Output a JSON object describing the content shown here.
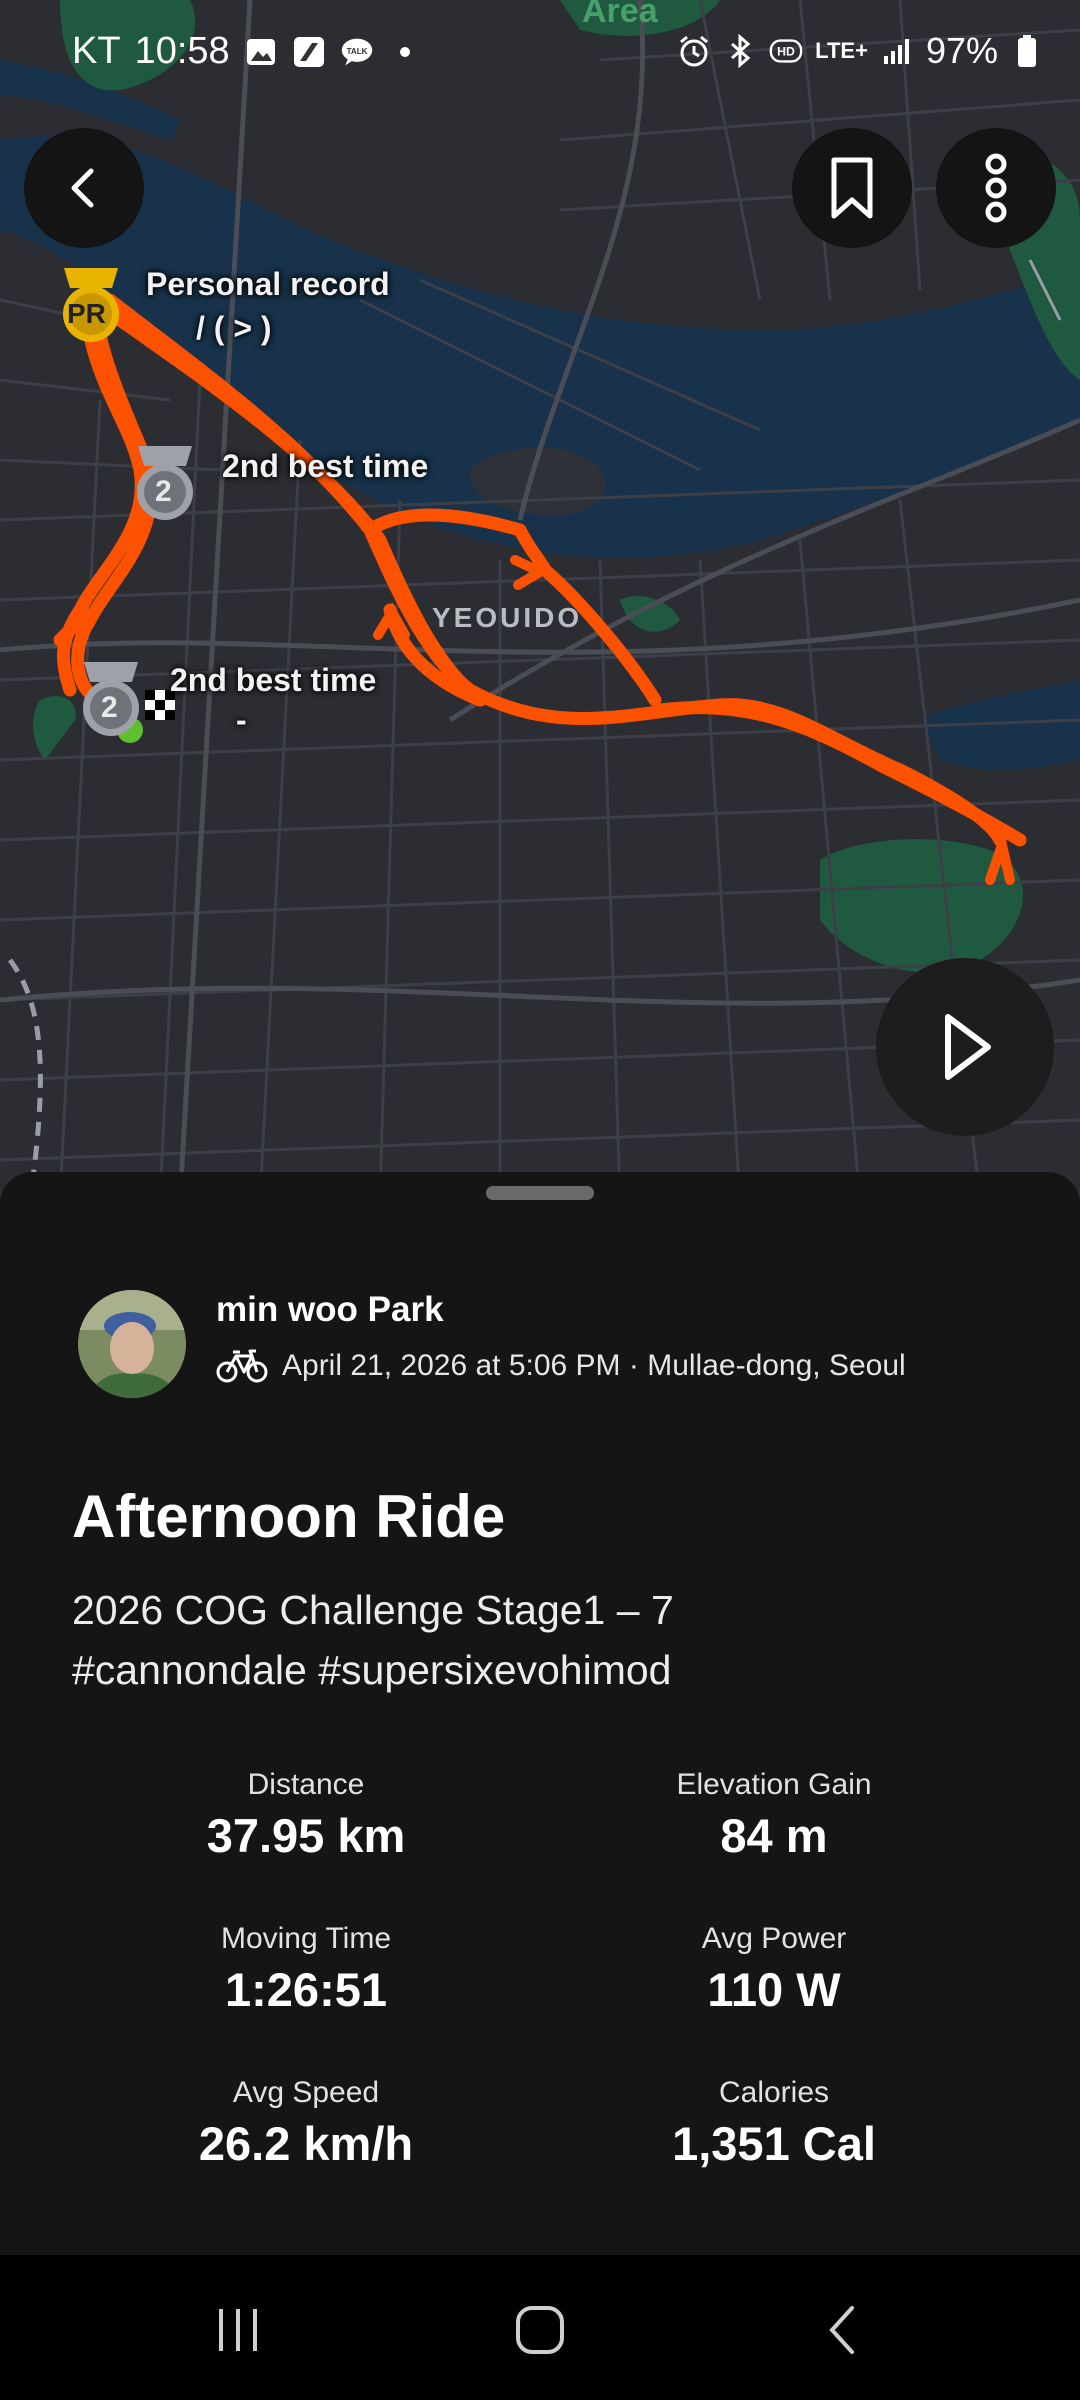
{
  "status_bar": {
    "carrier": "KT",
    "time": "10:58",
    "network": "LTE+",
    "battery": "97%",
    "icons": [
      "gallery-icon",
      "app-icon",
      "talk-icon",
      "dot-icon",
      "alarm-icon",
      "bluetooth-icon",
      "hd-icon",
      "lte-icon",
      "signal-icon",
      "battery-icon"
    ],
    "talk_icon_text": "TALK",
    "hd_icon_text": "HD"
  },
  "map": {
    "area_label": "Area",
    "district_label": "YEOUIDO",
    "markers": [
      {
        "badge": "PR",
        "title": "Personal record",
        "subtitle": "/ (  >     )"
      },
      {
        "badge": "2",
        "title": "2nd best time",
        "subtitle": ""
      },
      {
        "badge": "2",
        "title": "2nd best time",
        "subtitle": "-"
      }
    ],
    "buttons": {
      "back": "back-arrow-icon",
      "save": "bookmark-icon",
      "more": "more-vertical-icon",
      "play": "play-icon"
    },
    "colors": {
      "route": "#fc5200",
      "water": "#17324a",
      "park": "#1f5a40",
      "land": "#2b2d33"
    }
  },
  "activity": {
    "athlete": "min woo Park",
    "sport_icon": "bicycle-icon",
    "date_location": "April 21, 2026 at 5:06 PM · Mullae-dong, Seoul",
    "title": "Afternoon Ride",
    "description_line1": "2026  COG Challenge Stage1 – 7",
    "description_line2": "#cannondale  #supersixevohimod",
    "stats": [
      {
        "label": "Distance",
        "value": "37.95 km"
      },
      {
        "label": "Elevation Gain",
        "value": "84 m"
      },
      {
        "label": "Moving Time",
        "value": "1:26:51"
      },
      {
        "label": "Avg Power",
        "value": "110 W"
      },
      {
        "label": "Avg Speed",
        "value": "26.2 km/h"
      },
      {
        "label": "Calories",
        "value": "1,351 Cal"
      }
    ]
  },
  "nav_bar": {
    "buttons": [
      "recents-icon",
      "home-icon",
      "back-icon"
    ]
  }
}
